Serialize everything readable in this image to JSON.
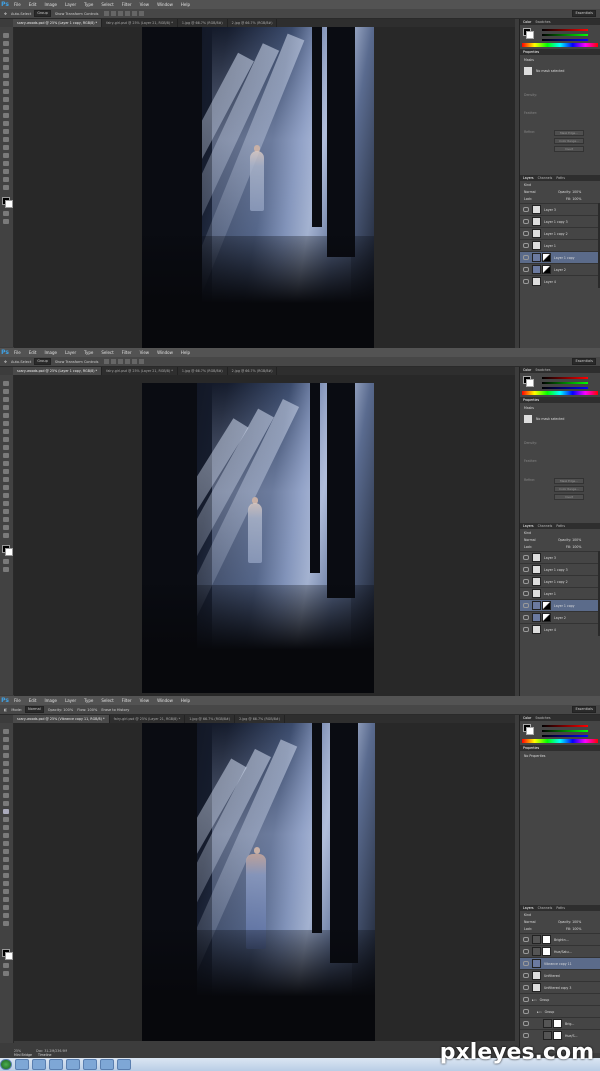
{
  "menu": [
    "File",
    "Edit",
    "Image",
    "Layer",
    "Type",
    "Select",
    "Filter",
    "View",
    "Window",
    "Help"
  ],
  "ps_logo": "Ps",
  "workspace": "Essentials",
  "screens": [
    {
      "options": {
        "auto_select": "Auto-Select",
        "group": "Group",
        "transform": "Show Transform Controls"
      },
      "tabs": [
        "scary-woods.psd @ 25% (Layer 1 copy, RGB/8) *",
        "fairy-girl.psd @ 25% (Layer 21, RGB/8) *",
        "1.jpg @ 66.7% (RGB/8#)",
        "2.jpg @ 66.7% (RGB/8#)"
      ],
      "properties": {
        "title": "Properties",
        "masks": "Masks",
        "no_mask": "No mask selected",
        "density": "Density:",
        "feather": "Feather:",
        "refine": "Refine:",
        "btns": [
          "Mask Edge...",
          "Color Range...",
          "Invert"
        ]
      },
      "layers_tabs": [
        "Layers",
        "Channels",
        "Paths"
      ],
      "kind": "Kind",
      "blend": "Normal",
      "opacity": "Opacity: 100%",
      "fill": "Fill: 100%",
      "lock": "Lock:",
      "layer_list": [
        "Layer 3",
        "Layer 1 copy 3",
        "Layer 1 copy 2",
        "Layer 1",
        "Layer 1 copy",
        "Layer 2",
        "Layer 4"
      ]
    },
    {
      "options": {
        "auto_select": "Auto-Select",
        "group": "Group",
        "transform": "Show Transform Controls"
      },
      "tabs": [
        "scary-woods.psd @ 25% (Layer 1 copy, RGB/8) *",
        "fairy-girl.psd @ 25% (Layer 21, RGB/8) *",
        "1.jpg @ 66.7% (RGB/8#)",
        "2.jpg @ 66.7% (RGB/8#)"
      ],
      "properties": {
        "title": "Properties",
        "masks": "Masks",
        "no_mask": "No mask selected",
        "density": "Density:",
        "feather": "Feather:",
        "refine": "Refine:",
        "btns": [
          "Mask Edge...",
          "Color Range...",
          "Invert"
        ]
      },
      "layers_tabs": [
        "Layers",
        "Channels",
        "Paths"
      ],
      "kind": "Kind",
      "blend": "Normal",
      "opacity": "Opacity: 100%",
      "fill": "Fill: 100%",
      "lock": "Lock:",
      "layer_list": [
        "Layer 3",
        "Layer 1 copy 3",
        "Layer 1 copy 2",
        "Layer 1",
        "Layer 1 copy",
        "Layer 2",
        "Layer 4"
      ]
    },
    {
      "options": {
        "mode_label": "Mode:",
        "mode": "Normal",
        "opacity": "Opacity: 100%",
        "flow": "Flow: 100%",
        "erase": "Erase to History"
      },
      "tabs": [
        "scary-woods.psd @ 25% (Vibrance copy 11, RGB/8) *",
        "fairy-girl.psd @ 25% (Layer 21, RGB/8) *",
        "1.jpg @ 66.7% (RGB/8#)",
        "2.jpg @ 66.7% (RGB/8#)"
      ],
      "properties": {
        "title": "Properties",
        "no_props": "No Properties"
      },
      "layers_tabs": [
        "Layers",
        "Channels",
        "Paths"
      ],
      "kind": "Kind",
      "blend": "Normal",
      "opacity": "Opacity: 100%",
      "fill": "Fill: 100%",
      "lock": "Lock:",
      "layer_list": [
        "Brightn...",
        "Hue/Satu...",
        "Vibrance copy 11",
        "Unfiltered",
        "Unfiltered copy 3",
        "Group",
        "Group",
        "Brig...",
        "Hue/S..."
      ]
    }
  ],
  "status": {
    "zoom": "25%",
    "doc": "Doc: 31.2M/236.9M"
  },
  "minibridge": [
    "Mini Bridge",
    "Timeline"
  ],
  "watermark": "pxleyes.com"
}
